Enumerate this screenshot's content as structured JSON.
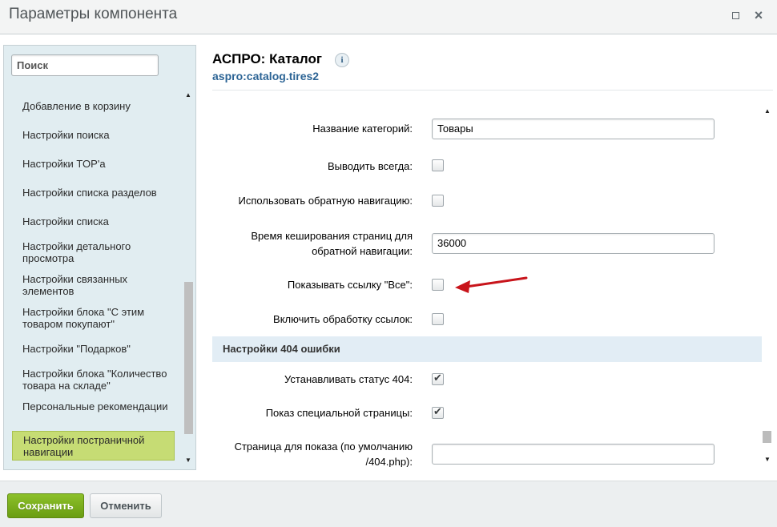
{
  "window": {
    "title": "Параметры компонента"
  },
  "sidebar": {
    "search_placeholder": "Поиск",
    "items": [
      {
        "label": "Добавление в корзину"
      },
      {
        "label": "Настройки поиска"
      },
      {
        "label": "Настройки TOP'а"
      },
      {
        "label": "Настройки списка разделов"
      },
      {
        "label": "Настройки списка"
      },
      {
        "label": "Настройки детального просмотра"
      },
      {
        "label": "Настройки связанных элементов"
      },
      {
        "label": "Настройки блока \"С этим товаром покупают\""
      },
      {
        "label": "Настройки \"Подарков\""
      },
      {
        "label": "Настройки блока \"Количество товара на складе\""
      },
      {
        "label": "Персональные рекомендации"
      },
      {
        "label": "Настройки постраничной навигации",
        "active": true
      }
    ]
  },
  "header": {
    "title": "АСПРО: Каталог",
    "info_icon_text": "i",
    "component_code": "aspro:catalog.tires2"
  },
  "form": {
    "category_name": {
      "label": "Название категорий:",
      "value": "Товары"
    },
    "show_always": {
      "label": "Выводить всегда:",
      "checked": false
    },
    "reverse_nav": {
      "label": "Использовать обратную навигацию:",
      "checked": false
    },
    "cache_time": {
      "label": "Время кеширования страниц для обратной навигации:",
      "value": "36000"
    },
    "show_all_link": {
      "label": "Показывать ссылку \"Все\":",
      "checked": false
    },
    "link_processing": {
      "label": "Включить обработку ссылок:",
      "checked": false
    },
    "section_404": {
      "title": "Настройки 404 ошибки"
    },
    "set_status_404": {
      "label": "Устанавливать статус 404:",
      "checked": true
    },
    "show_special_page": {
      "label": "Показ специальной страницы:",
      "checked": true
    },
    "page_to_show": {
      "label": "Страница для показа (по умолчанию /404.php):",
      "value": ""
    }
  },
  "annotation": {
    "color": "#c8141b"
  },
  "footer": {
    "save_label": "Сохранить",
    "cancel_label": "Отменить"
  },
  "colors": {
    "active_item": "#c6dc74",
    "save_button": "#7bb01e",
    "link_blue": "#2c6495"
  }
}
